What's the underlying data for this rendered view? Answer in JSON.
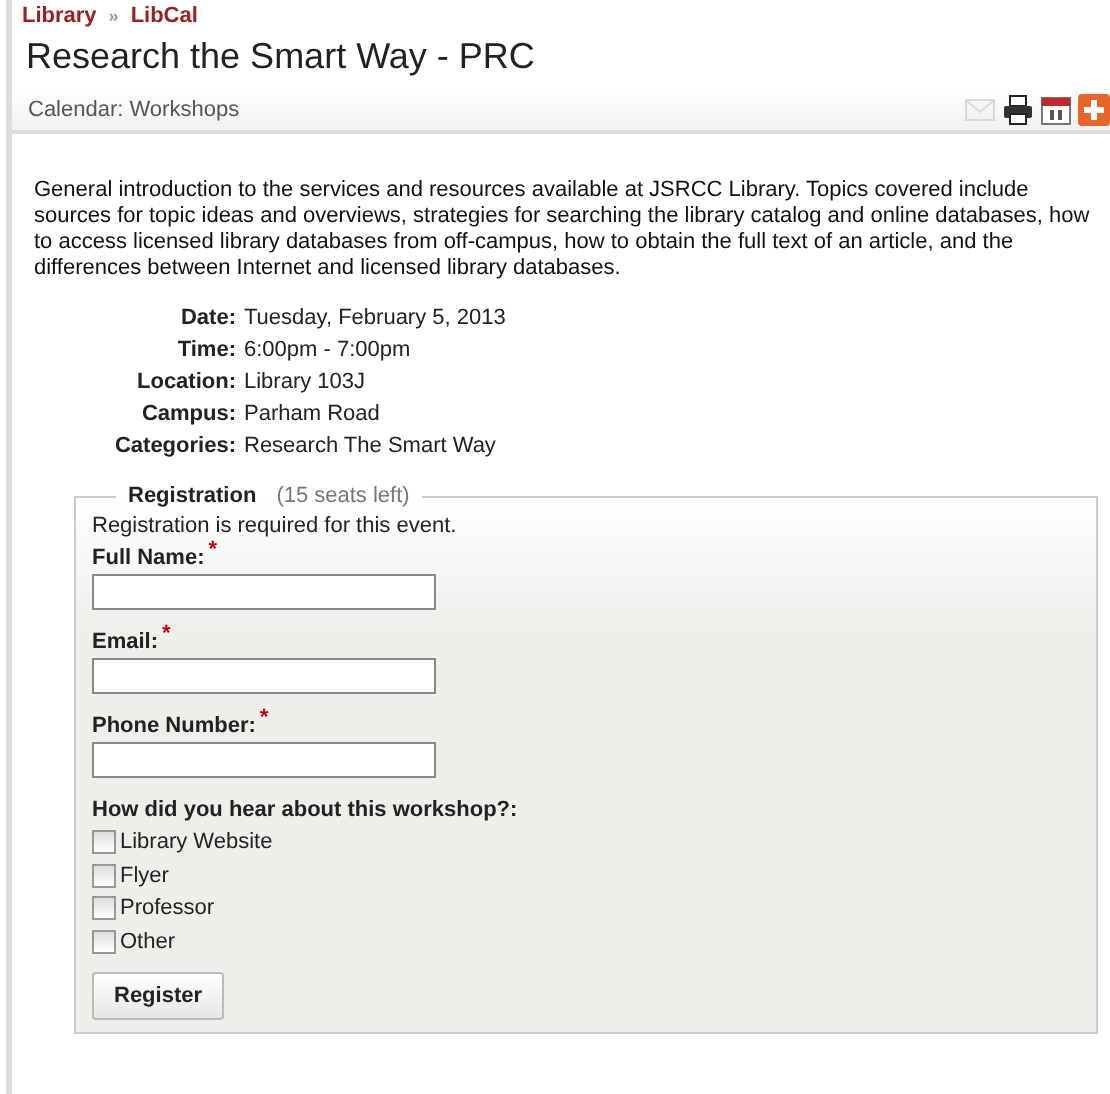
{
  "breadcrumb": [
    {
      "label": "Library"
    },
    {
      "label": "LibCal"
    }
  ],
  "breadcrumb_separator": "»",
  "title": "Research the Smart Way - PRC",
  "calendar_label": "Calendar: Workshops",
  "toolbar": [
    {
      "kind": "email",
      "disabled": true
    },
    {
      "kind": "print",
      "disabled": false
    },
    {
      "kind": "calendar",
      "disabled": false
    },
    {
      "kind": "add",
      "disabled": false
    }
  ],
  "description": "General introduction to the services and resources available at JSRCC Library.  Topics covered include sources for topic ideas and overviews, strategies for searching the library catalog and online databases, how to access licensed library databases from off-campus, how to obtain the full text of an article, and the differences between Internet and licensed library databases.",
  "details": [
    {
      "label": "Date:",
      "value": "Tuesday, February 5, 2013"
    },
    {
      "label": "Time:",
      "value": "6:00pm - 7:00pm"
    },
    {
      "label": "Location:",
      "value": "Library 103J"
    },
    {
      "label": "Campus:",
      "value": "Parham Road"
    },
    {
      "label": "Categories:",
      "value": "Research The Smart Way"
    }
  ],
  "registration": {
    "legend": "Registration",
    "seats": "(15 seats left)",
    "note": "Registration is required for this event.",
    "fields": [
      {
        "label": "Full Name:",
        "required_mark": "*"
      },
      {
        "label": "Email:",
        "required_mark": "*"
      },
      {
        "label": "Phone Number:",
        "required_mark": "*"
      }
    ],
    "question": "How did you hear about this workshop?:",
    "options": [
      {
        "label": "Library Website",
        "checked": false
      },
      {
        "label": "Flyer",
        "checked": false
      },
      {
        "label": "Professor",
        "checked": false
      },
      {
        "label": "Other",
        "checked": false
      }
    ],
    "submit": "Register"
  }
}
